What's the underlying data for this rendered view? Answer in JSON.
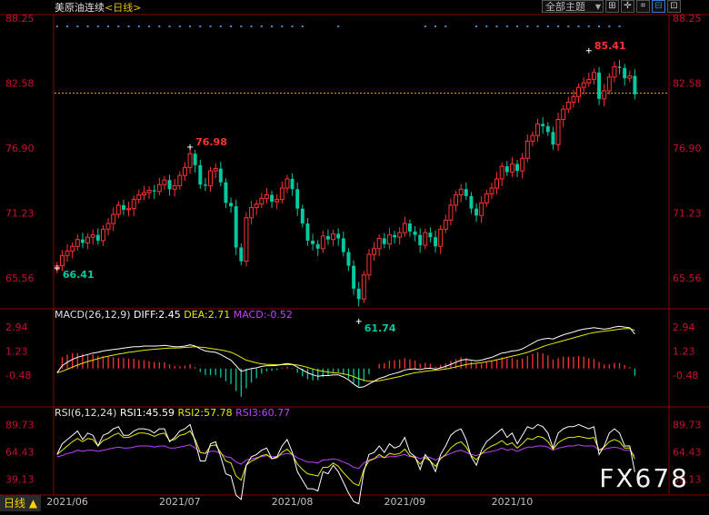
{
  "header": {
    "symbol": "美原油连续",
    "period": "日线",
    "view_select": "全部主题",
    "buttons": [
      "⊞",
      "✛",
      "⌗",
      "⊟",
      "⊡"
    ]
  },
  "colors": {
    "up": "#ff3333",
    "down": "#00c8a0",
    "axis": "#c8102e",
    "diff": "#ffffff",
    "dea": "#e8e800",
    "rsi1": "#ffffff",
    "rsi2": "#e8e800",
    "rsi3": "#c040ff",
    "dots": "#3a8fd8",
    "current_price_line": "#e8a000"
  },
  "chart_data": [
    {
      "type": "candlestick",
      "name": "price",
      "ylim": [
        63.0,
        88.25
      ],
      "y_ticks": [
        88.25,
        82.58,
        76.9,
        71.23,
        65.56
      ],
      "current_price": 81.7,
      "x_labels": [
        "2021/06",
        "2021/07",
        "2021/08",
        "2021/09",
        "2021/10"
      ],
      "x_label_index": [
        2,
        24,
        46,
        68,
        89
      ],
      "annotations": [
        {
          "text": "76.98",
          "index": 26,
          "value": 76.98,
          "kind": "high"
        },
        {
          "text": "66.41",
          "index": 0,
          "value": 66.41,
          "kind": "low"
        },
        {
          "text": "61.74",
          "index": 59,
          "value": 61.74,
          "kind": "low"
        },
        {
          "text": "85.41",
          "index": 104,
          "value": 85.41,
          "kind": "high"
        }
      ],
      "closes": [
        66.6,
        67.5,
        67.9,
        68.3,
        68.9,
        68.6,
        69.1,
        69.3,
        68.8,
        69.8,
        70.3,
        71.1,
        71.9,
        71.5,
        71.6,
        72.4,
        72.8,
        73.0,
        73.2,
        73.1,
        73.7,
        74.1,
        73.3,
        73.6,
        74.5,
        75.2,
        76.4,
        75.4,
        73.7,
        73.6,
        74.9,
        75.1,
        73.9,
        72.1,
        71.8,
        68.2,
        67.0,
        70.8,
        71.7,
        72.0,
        72.5,
        72.8,
        72.2,
        72.4,
        73.4,
        74.2,
        73.3,
        71.6,
        70.3,
        68.8,
        68.5,
        68.1,
        69.2,
        68.9,
        69.4,
        69.0,
        67.8,
        66.6,
        64.6,
        63.7,
        65.8,
        67.6,
        68.1,
        69.0,
        68.5,
        69.3,
        69.1,
        69.5,
        70.3,
        69.6,
        69.3,
        68.4,
        69.5,
        69.1,
        68.3,
        69.8,
        70.6,
        71.9,
        72.8,
        73.3,
        72.7,
        71.6,
        71.0,
        72.1,
        72.9,
        73.4,
        74.2,
        75.3,
        74.8,
        75.5,
        74.9,
        76.0,
        77.5,
        78.0,
        79.0,
        78.8,
        78.3,
        77.2,
        79.4,
        80.3,
        80.9,
        81.4,
        82.2,
        82.6,
        82.9,
        83.5,
        81.2,
        81.9,
        83.1,
        84.0,
        83.9,
        83.0,
        83.2,
        81.6
      ],
      "x_span": 120,
      "dots_marker_ranges": [
        [
          0,
          48
        ],
        [
          55,
          55
        ],
        [
          72,
          76
        ],
        [
          82,
          110
        ]
      ]
    },
    {
      "type": "line",
      "name": "MACD",
      "label": "MACD(26,12,9)",
      "legend": {
        "diff": "DIFF:2.45",
        "dea": "DEA:2.71",
        "macd": "MACD:-0.52"
      },
      "ylim": [
        -2.6,
        3.6
      ],
      "y_ticks": [
        2.94,
        1.23,
        -0.48
      ],
      "diff": [
        -0.3,
        0.2,
        0.45,
        0.65,
        0.8,
        0.9,
        1.0,
        1.1,
        1.15,
        1.25,
        1.3,
        1.35,
        1.4,
        1.45,
        1.5,
        1.55,
        1.55,
        1.6,
        1.6,
        1.6,
        1.62,
        1.65,
        1.6,
        1.55,
        1.55,
        1.6,
        1.68,
        1.6,
        1.4,
        1.25,
        1.2,
        1.15,
        1.0,
        0.8,
        0.6,
        0.2,
        -0.2,
        -0.1,
        0.0,
        0.05,
        0.15,
        0.2,
        0.2,
        0.22,
        0.3,
        0.35,
        0.3,
        0.1,
        -0.1,
        -0.3,
        -0.45,
        -0.55,
        -0.5,
        -0.5,
        -0.45,
        -0.45,
        -0.6,
        -0.8,
        -1.1,
        -1.35,
        -1.3,
        -1.1,
        -0.9,
        -0.7,
        -0.6,
        -0.45,
        -0.35,
        -0.25,
        -0.1,
        -0.05,
        -0.02,
        -0.08,
        0.0,
        0.02,
        -0.05,
        0.05,
        0.15,
        0.3,
        0.45,
        0.6,
        0.65,
        0.6,
        0.55,
        0.6,
        0.7,
        0.8,
        0.95,
        1.1,
        1.15,
        1.25,
        1.28,
        1.4,
        1.6,
        1.8,
        2.0,
        2.1,
        2.15,
        2.1,
        2.25,
        2.4,
        2.5,
        2.6,
        2.72,
        2.8,
        2.85,
        2.9,
        2.85,
        2.8,
        2.85,
        2.95,
        3.0,
        2.95,
        2.9,
        2.45
      ],
      "dea": [
        -0.3,
        -0.2,
        -0.05,
        0.1,
        0.25,
        0.38,
        0.5,
        0.6,
        0.7,
        0.8,
        0.88,
        0.95,
        1.02,
        1.08,
        1.15,
        1.2,
        1.25,
        1.3,
        1.34,
        1.37,
        1.4,
        1.43,
        1.45,
        1.46,
        1.47,
        1.5,
        1.53,
        1.55,
        1.52,
        1.48,
        1.43,
        1.38,
        1.32,
        1.25,
        1.15,
        1.0,
        0.8,
        0.6,
        0.5,
        0.4,
        0.33,
        0.3,
        0.28,
        0.27,
        0.27,
        0.28,
        0.28,
        0.25,
        0.18,
        0.08,
        -0.03,
        -0.13,
        -0.2,
        -0.25,
        -0.3,
        -0.32,
        -0.38,
        -0.45,
        -0.58,
        -0.72,
        -0.84,
        -0.9,
        -0.9,
        -0.86,
        -0.8,
        -0.73,
        -0.65,
        -0.57,
        -0.47,
        -0.38,
        -0.3,
        -0.25,
        -0.2,
        -0.15,
        -0.12,
        -0.08,
        -0.03,
        0.03,
        0.12,
        0.2,
        0.28,
        0.34,
        0.38,
        0.42,
        0.48,
        0.54,
        0.62,
        0.7,
        0.79,
        0.88,
        0.96,
        1.05,
        1.15,
        1.28,
        1.42,
        1.56,
        1.68,
        1.78,
        1.88,
        1.98,
        2.08,
        2.18,
        2.28,
        2.38,
        2.48,
        2.56,
        2.62,
        2.66,
        2.7,
        2.75,
        2.8,
        2.83,
        2.85,
        2.71
      ],
      "macd": [
        0,
        0.8,
        1.0,
        1.1,
        1.1,
        1.05,
        1.0,
        1.0,
        0.9,
        0.9,
        0.84,
        0.8,
        0.76,
        0.74,
        0.7,
        0.7,
        0.6,
        0.6,
        0.52,
        0.46,
        0.44,
        0.44,
        0.3,
        0.18,
        0.16,
        0.2,
        0.3,
        0.1,
        -0.24,
        -0.46,
        -0.46,
        -0.46,
        -0.64,
        -0.9,
        -1.1,
        -1.6,
        -2.0,
        -1.4,
        -1.0,
        -0.7,
        -0.36,
        -0.2,
        -0.16,
        -0.1,
        0.06,
        0.14,
        0.04,
        -0.3,
        -0.56,
        -0.76,
        -0.84,
        -0.84,
        -0.6,
        -0.5,
        -0.3,
        -0.26,
        -0.44,
        -0.7,
        -1.04,
        -1.26,
        -0.92,
        -0.4,
        0.0,
        0.32,
        0.4,
        0.56,
        0.6,
        0.64,
        0.74,
        0.66,
        0.56,
        0.34,
        0.4,
        0.34,
        0.14,
        0.26,
        0.36,
        0.54,
        0.66,
        0.8,
        0.74,
        0.52,
        0.34,
        0.36,
        0.44,
        0.52,
        0.66,
        0.8,
        0.72,
        0.74,
        0.64,
        0.7,
        0.9,
        1.04,
        1.16,
        1.08,
        0.94,
        0.64,
        0.74,
        0.84,
        0.84,
        0.84,
        0.88,
        0.84,
        0.74,
        0.68,
        0.46,
        0.28,
        0.3,
        0.4,
        0.4,
        0.24,
        0.1,
        -0.52
      ]
    },
    {
      "type": "line",
      "name": "RSI",
      "label": "RSI(6,12,24)",
      "legend": {
        "rsi1": "RSI1:45.59",
        "rsi2": "RSI2:57.78",
        "rsi3": "RSI3:60.77"
      },
      "ylim": [
        25.0,
        98.0
      ],
      "y_ticks": [
        89.73,
        64.43,
        39.13
      ],
      "rsi1": [
        62,
        72,
        76,
        80,
        84,
        76,
        82,
        80,
        70,
        80,
        82,
        86,
        88,
        80,
        80,
        84,
        86,
        86,
        85,
        82,
        86,
        86,
        74,
        78,
        84,
        86,
        90,
        74,
        56,
        56,
        72,
        74,
        60,
        44,
        42,
        24,
        20,
        52,
        60,
        62,
        66,
        68,
        58,
        60,
        70,
        76,
        64,
        46,
        38,
        30,
        30,
        28,
        46,
        44,
        52,
        46,
        36,
        26,
        18,
        16,
        46,
        62,
        64,
        70,
        64,
        72,
        68,
        70,
        78,
        64,
        60,
        48,
        62,
        56,
        46,
        62,
        70,
        80,
        84,
        86,
        76,
        60,
        52,
        66,
        74,
        78,
        82,
        86,
        78,
        82,
        72,
        80,
        88,
        86,
        90,
        88,
        82,
        68,
        82,
        86,
        88,
        88,
        90,
        88,
        86,
        88,
        62,
        70,
        82,
        86,
        82,
        70,
        70,
        45.59
      ],
      "rsi2": [
        62,
        66,
        70,
        74,
        77,
        74,
        77,
        76,
        70,
        75,
        77,
        80,
        82,
        78,
        78,
        80,
        82,
        82,
        81,
        79,
        81,
        82,
        75,
        76,
        80,
        81,
        84,
        76,
        64,
        63,
        70,
        71,
        64,
        56,
        54,
        42,
        38,
        52,
        56,
        58,
        61,
        62,
        58,
        59,
        64,
        67,
        62,
        53,
        48,
        44,
        43,
        42,
        50,
        50,
        54,
        51,
        45,
        40,
        35,
        33,
        48,
        56,
        58,
        62,
        59,
        63,
        62,
        63,
        67,
        61,
        59,
        53,
        59,
        56,
        51,
        58,
        62,
        68,
        72,
        74,
        69,
        61,
        57,
        63,
        67,
        70,
        72,
        75,
        71,
        73,
        68,
        72,
        77,
        76,
        79,
        78,
        74,
        67,
        73,
        76,
        78,
        78,
        79,
        78,
        77,
        78,
        66,
        69,
        74,
        76,
        74,
        68,
        68,
        57.78
      ],
      "rsi3": [
        60,
        61,
        63,
        64,
        66,
        65,
        66,
        66,
        65,
        66,
        67,
        68,
        69,
        68,
        68,
        69,
        70,
        70,
        70,
        69,
        70,
        70,
        68,
        68,
        69,
        70,
        71,
        68,
        64,
        63,
        65,
        65,
        63,
        60,
        59,
        55,
        53,
        57,
        58,
        59,
        60,
        61,
        60,
        60,
        62,
        63,
        62,
        59,
        57,
        55,
        55,
        54,
        57,
        57,
        58,
        57,
        55,
        53,
        50,
        49,
        54,
        57,
        58,
        60,
        59,
        60,
        60,
        61,
        62,
        60,
        60,
        58,
        60,
        59,
        57,
        59,
        61,
        63,
        65,
        66,
        64,
        62,
        61,
        63,
        64,
        65,
        66,
        68,
        66,
        67,
        65,
        67,
        69,
        69,
        70,
        70,
        69,
        66,
        68,
        69,
        70,
        70,
        71,
        70,
        70,
        70,
        66,
        67,
        68,
        69,
        68,
        66,
        66,
        60.77
      ]
    }
  ]
}
